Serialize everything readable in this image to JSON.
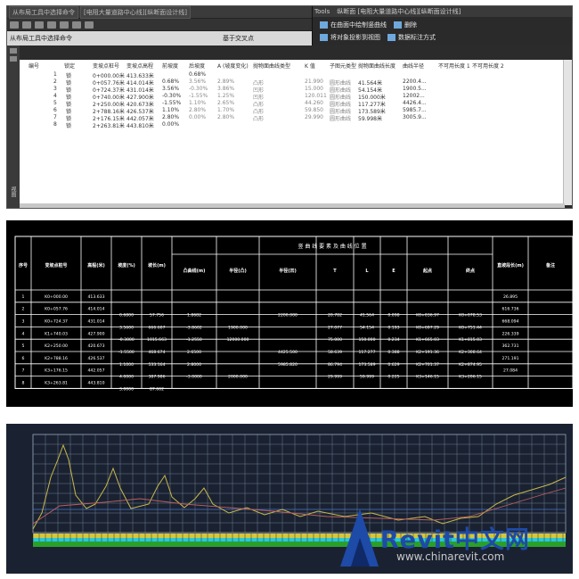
{
  "panel1": {
    "tabs": [
      "从布局工具中选择命令",
      "[电阻大量道路中心线][纵断面设计线]",
      "Tools",
      "纵断面 [电阻大量道路中心线][纵断面设计线]"
    ],
    "status_left": "从布局工具中选择命令",
    "status_center": "基于交叉点",
    "tool_buttons": [
      "在曲面中绘制竖曲线",
      "删除",
      "将对象投影到视图",
      "数据标注方式"
    ],
    "left_vertical_text": "视图",
    "columns": [
      "编号",
      "锁定",
      "变坡点桩号",
      "变坡点高程",
      "前坡度",
      "后坡度",
      "A (坡度变化)",
      "抛物面曲线类型",
      "K 值",
      "子图元类型",
      "抛物面曲线长度",
      "曲线半径",
      "不可用长度 1",
      "不可用长度 2"
    ],
    "rows": [
      [
        "1",
        "锁",
        "0+000.00米",
        "413.633米",
        "",
        "0.68%",
        "",
        "",
        "",
        "",
        "",
        "",
        "",
        ""
      ],
      [
        "2",
        "锁",
        "0+057.76米",
        "414.014米",
        "0.68%",
        "3.56%",
        "2.89%",
        "凸形",
        "21.990",
        "圆形曲线",
        "41.564米",
        "2200.4...",
        "",
        ""
      ],
      [
        "3",
        "锁",
        "0+724.37米",
        "431.014米",
        "3.56%",
        "-0.30%",
        "3.86%",
        "凹形",
        "15.000",
        "圆形曲线",
        "54.154米",
        "1900.5...",
        "",
        ""
      ],
      [
        "4",
        "锁",
        "0+740.00米",
        "427.900米",
        "-0.30%",
        "-1.55%",
        "1.25%",
        "凹形",
        "120.011",
        "圆形曲线",
        "150.000米",
        "12002...",
        "",
        ""
      ],
      [
        "5",
        "锁",
        "2+250.00米",
        "420.673米",
        "-1.55%",
        "1.10%",
        "2.65%",
        "凸形",
        "44.260",
        "圆形曲线",
        "117.277米",
        "4426.4...",
        "",
        ""
      ],
      [
        "6",
        "锁",
        "2+788.16米",
        "426.537米",
        "1.10%",
        "2.80%",
        "1.70%",
        "凸形",
        "59.850",
        "圆形曲线",
        "173.589米",
        "5985.7...",
        "",
        ""
      ],
      [
        "7",
        "锁",
        "2+176.15米",
        "442.057米",
        "2.80%",
        "0.00%",
        "2.80%",
        "凸形",
        "29.990",
        "圆形曲线",
        "59.998米",
        "3005.9...",
        "",
        ""
      ],
      [
        "8",
        "锁",
        "2+263.81米",
        "443.810米",
        "0.00%",
        "",
        "",
        "",
        "",
        "",
        "",
        "",
        "",
        ""
      ]
    ]
  },
  "panel2": {
    "title_banner": "竖 曲 线 要 素 及 曲 线 位 置",
    "headers": [
      "序号",
      "变坡点桩号",
      "高程(米)",
      "坡度(%)",
      "坡长(m)",
      "凸曲线(m)",
      "半径(凸)",
      "半径(凹)",
      "T",
      "L",
      "E",
      "起点",
      "终点",
      "直坡段长(m)",
      "备注"
    ],
    "rows": [
      [
        "1",
        "K0+000.00",
        "413.633",
        "",
        "",
        "",
        "",
        "",
        "",
        "",
        "",
        "",
        "",
        "26.895",
        ""
      ],
      [
        "2",
        "K0+057.76",
        "414.014",
        "0.6800",
        "57.756",
        "1.8682",
        "",
        "2200.000",
        "20.782",
        "41.564",
        "0.098",
        "K0+036.97",
        "K0+078.53",
        "616.736",
        ""
      ],
      [
        "3",
        "K0+724.37",
        "431.014",
        "3.5600",
        "666.607",
        "-3.8602",
        "1900.000",
        "",
        "27.077",
        "54.154",
        "0.193",
        "K0+697.29",
        "K0+751.44",
        "668.094",
        ""
      ],
      [
        "4",
        "K1+740.03",
        "427.900",
        "-0.3000",
        "1015.663",
        "-1.2550",
        "12000.000",
        "",
        "75.000",
        "150.000",
        "0.234",
        "K1+665.03",
        "K1+815.03",
        "226.339",
        ""
      ],
      [
        "5",
        "K2+250.00",
        "420.673",
        "-1.5500",
        "468.674",
        "2.6500",
        "",
        "4425.500",
        "58.639",
        "117.277",
        "0.388",
        "K2+191.36",
        "K2+308.64",
        "362.731",
        ""
      ],
      [
        "6",
        "K2+788.16",
        "426.537",
        "1.1000",
        "533.164",
        "2.8000",
        "",
        "5985.820",
        "86.794",
        "173.589",
        "0.629",
        "K2+701.37",
        "K2+874.95",
        "271.191",
        ""
      ],
      [
        "7",
        "K3+176.15",
        "442.057",
        "4.0000",
        "387.986",
        "-3.0000",
        "2000.000",
        "",
        "29.999",
        "59.999",
        "0.225",
        "K3+146.15",
        "K3+206.15",
        "27.084",
        ""
      ],
      [
        "8",
        "K3+263.81",
        "443.810",
        "3.0000",
        "87.662",
        "",
        "",
        "",
        "",
        "",
        "",
        "",
        "",
        "",
        ""
      ]
    ]
  },
  "panel3": {
    "watermark_main": "Revit中文网",
    "watermark_url": "www.chinarevit.com",
    "colors": {
      "grid": "#8fa0b0",
      "ground_line": "#c8b84a",
      "design_line": "#b86060",
      "cyan": "#2cc7d8",
      "green_band": "#2aa02a",
      "yellow_band": "#d4c640",
      "logo": "#1e4aa8"
    }
  }
}
